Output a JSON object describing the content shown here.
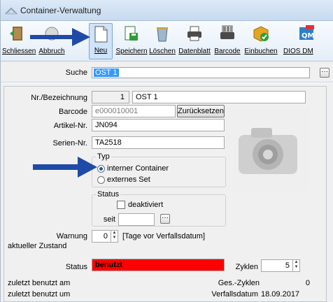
{
  "window": {
    "title": "Container-Verwaltung"
  },
  "toolbar": {
    "buttons": [
      {
        "label": "Schliessen",
        "icon": "close-door-icon"
      },
      {
        "label": "Abbruch",
        "icon": "cancel-icon"
      },
      {
        "label": "Neu",
        "icon": "new-document-icon"
      },
      {
        "label": "Speichern",
        "icon": "save-icon"
      },
      {
        "label": "Löschen",
        "icon": "trash-icon"
      },
      {
        "label": "Datenblatt",
        "icon": "printer-icon"
      },
      {
        "label": "Barcode",
        "icon": "barcode-printer-icon"
      },
      {
        "label": "Einbuchen",
        "icon": "package-check-icon"
      },
      {
        "label": "DIOS DM",
        "icon": "pdf-qm-icon"
      }
    ]
  },
  "search": {
    "label": "Suche",
    "value": "OST 1"
  },
  "form": {
    "nr_label": "Nr./Bezeichnung",
    "nr_value": "1",
    "bezeichnung_value": "OST 1",
    "barcode_label": "Barcode",
    "barcode_value": "e000010001",
    "reset_button": "Zurücksetzen",
    "artikel_label": "Artikel-Nr.",
    "artikel_value": "JN094",
    "serien_label": "Serien-Nr.",
    "serien_value": "TA2518",
    "typ_title": "Typ",
    "typ_options": [
      "interner Container",
      "externes Set"
    ],
    "typ_selected": "interner Container",
    "status_title": "Status",
    "deaktiviert_label": "deaktiviert",
    "seit_label": "seit",
    "warnung_label": "Warnung",
    "warnung_value": "0",
    "warnung_unit": "[Tage vor Verfallsdatum]",
    "zustand_label": "aktueller Zustand",
    "status_label": "Status",
    "status_value": "benutzt",
    "status_color": "#ff0000",
    "zyklen_label": "Zyklen",
    "zyklen_value": "5",
    "zuletzt_am_label": "zuletzt benutzt am",
    "ges_zyklen_label": "Ges.-Zyklen",
    "ges_zyklen_value": "0",
    "zuletzt_um_label": "zuletzt benutzt um",
    "verfall_label": "Verfallsdatum",
    "verfall_value": "18.09.2017"
  },
  "colors": {
    "annotation_arrow": "#1f4aa8",
    "selection": "#3399ff"
  }
}
